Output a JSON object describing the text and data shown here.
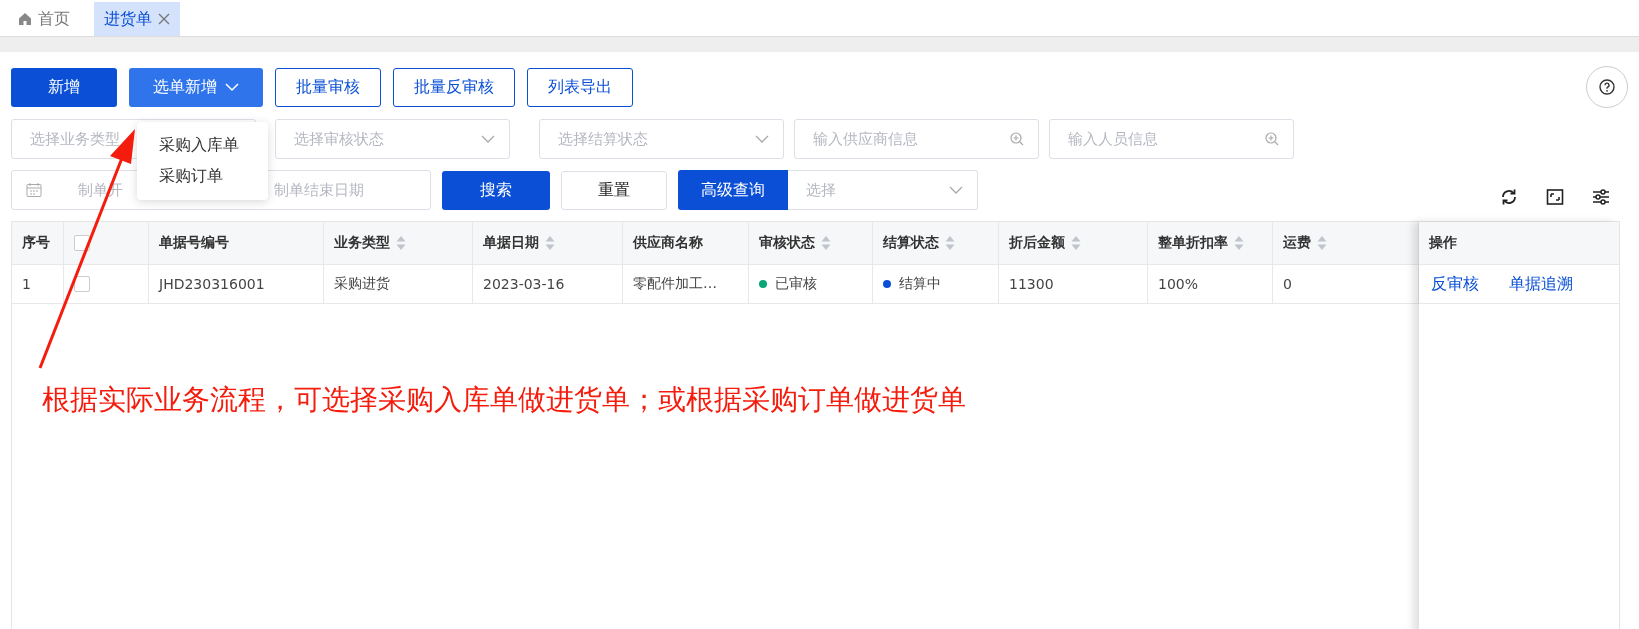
{
  "tabs": [
    {
      "label": "首页",
      "kind": "home",
      "selected": false
    },
    {
      "label": "进货单",
      "kind": "page",
      "selected": true
    }
  ],
  "toolbar": [
    {
      "label": "新增",
      "kind": "primary"
    },
    {
      "label": "选单新增",
      "kind": "dropdown"
    },
    {
      "label": "批量审核",
      "kind": "outline"
    },
    {
      "label": "批量反审核",
      "kind": "outline"
    },
    {
      "label": "列表导出",
      "kind": "outline"
    }
  ],
  "dropdown_menu": [
    "采购入库单",
    "采购订单"
  ],
  "filters": [
    {
      "placeholder": "选择业务类型",
      "kind": "plain"
    },
    {
      "placeholder": "选择审核状态",
      "kind": "select"
    },
    {
      "placeholder": "选择结算状态",
      "kind": "select"
    },
    {
      "placeholder": "输入供应商信息",
      "kind": "search"
    },
    {
      "placeholder": "输入人员信息",
      "kind": "search"
    }
  ],
  "date_range": {
    "start_placeholder": "制单开",
    "end_placeholder": "制单结束日期"
  },
  "search_button": "搜索",
  "reset_button": "重置",
  "advanced_query": {
    "label": "高级查询",
    "placeholder": "选择"
  },
  "table": {
    "columns": [
      {
        "label": "序号",
        "kind": "text"
      },
      {
        "kind": "checkbox",
        "sortable": false,
        "checked": false
      },
      {
        "label": "单据号编号",
        "kind": "text",
        "sortable": false
      },
      {
        "label": "业务类型",
        "kind": "text",
        "sortable": true
      },
      {
        "label": "单据日期",
        "kind": "text",
        "sortable": true
      },
      {
        "label": "供应商名称",
        "kind": "text",
        "sortable": false
      },
      {
        "label": "审核状态",
        "kind": "status",
        "sortable": true
      },
      {
        "label": "结算状态",
        "kind": "status",
        "sortable": true
      },
      {
        "label": "折后金额",
        "kind": "text",
        "sortable": true
      },
      {
        "label": "整单折扣率",
        "kind": "text",
        "sortable": true
      },
      {
        "label": "运费",
        "kind": "text",
        "sortable": true
      }
    ],
    "action_column": "操作",
    "rows": [
      {
        "cells": [
          {
            "text": "1"
          },
          {
            "checked": false
          },
          {
            "text": "JHD230316001"
          },
          {
            "text": "采购进货"
          },
          {
            "text": "2023-03-16"
          },
          {
            "text": "零配件加工…"
          },
          {
            "text": "已审核",
            "color": "#0aa679"
          },
          {
            "text": "结算中",
            "color": "#0a4fd6"
          },
          {
            "text": "11300"
          },
          {
            "text": "100%"
          },
          {
            "text": "0"
          }
        ],
        "actions": [
          "反审核",
          "单据追溯"
        ]
      }
    ]
  },
  "annotation": "根据实际业务流程，可选择采购入库单做进货单；或根据采购订单做进货单"
}
